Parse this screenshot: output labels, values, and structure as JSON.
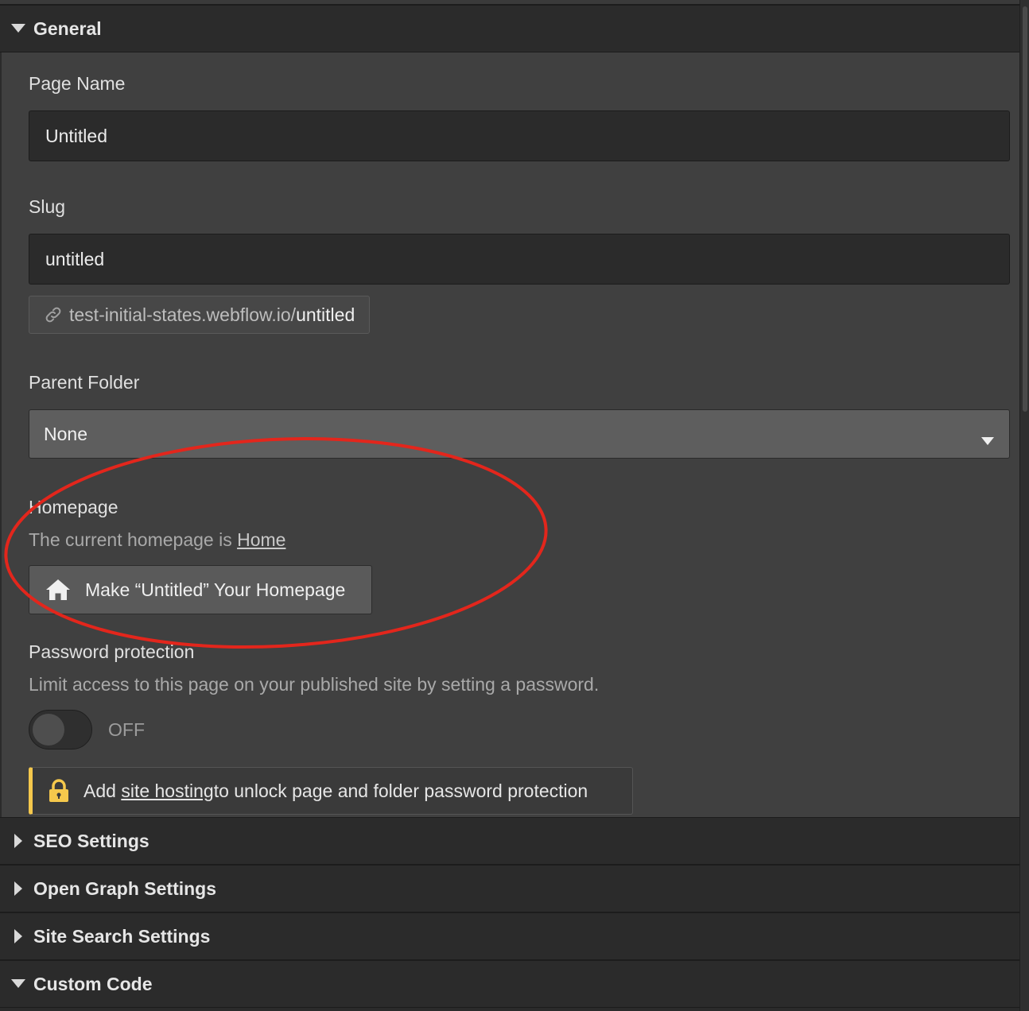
{
  "sections": {
    "general": {
      "title": "General",
      "expanded": true
    },
    "seo": {
      "title": "SEO Settings",
      "expanded": false
    },
    "open_graph": {
      "title": "Open Graph Settings",
      "expanded": false
    },
    "site_search": {
      "title": "Site Search Settings",
      "expanded": false
    },
    "custom_code": {
      "title": "Custom Code",
      "expanded": true
    }
  },
  "general": {
    "page_name": {
      "label": "Page Name",
      "value": "Untitled"
    },
    "slug": {
      "label": "Slug",
      "value": "untitled"
    },
    "url": {
      "domain": "test-initial-states.webflow.io/",
      "slug": "untitled"
    },
    "parent_folder": {
      "label": "Parent Folder",
      "selected": "None"
    },
    "homepage": {
      "label": "Homepage",
      "text_prefix": "The current homepage is ",
      "link": "Home",
      "button": "Make “Untitled” Your Homepage"
    },
    "password": {
      "label": "Password protection",
      "description": "Limit access to this page on your published site by setting a password.",
      "toggle_state": "OFF",
      "notice_prefix": "Add ",
      "notice_link": "site hosting",
      "notice_suffix": " to unlock page and folder password protection"
    }
  },
  "colors": {
    "accent_warning": "#f5c84c",
    "annotation": "#e3261c"
  },
  "icons": [
    "caret-down-icon",
    "caret-right-icon",
    "link-icon",
    "dropdown-arrow-icon",
    "home-icon",
    "lock-icon"
  ]
}
